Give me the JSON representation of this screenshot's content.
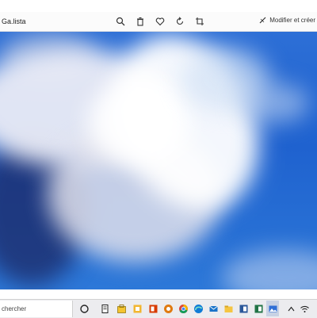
{
  "window": {
    "filename": "Ga.lista",
    "toolbar_icons": [
      "zoom-icon",
      "delete-icon",
      "favorite-icon",
      "rotate-icon",
      "crop-icon"
    ],
    "edit_create_label": "Modifier et créer"
  },
  "photo": {
    "subject": "blurred white cloud in blue sky",
    "colors": {
      "sky": "#1f62cf",
      "cloud": "#ffffff"
    }
  },
  "taskbar": {
    "search_text": "chercher",
    "apps": [
      "task-view-icon",
      "store-icon",
      "sticky-notes-icon",
      "office-icon",
      "stopwatch-icon",
      "chrome-icon",
      "edge-icon",
      "mail-icon",
      "file-explorer-icon",
      "word-icon",
      "excel-icon",
      "photos-icon",
      "system-tray-icon",
      "wifi-icon"
    ]
  }
}
